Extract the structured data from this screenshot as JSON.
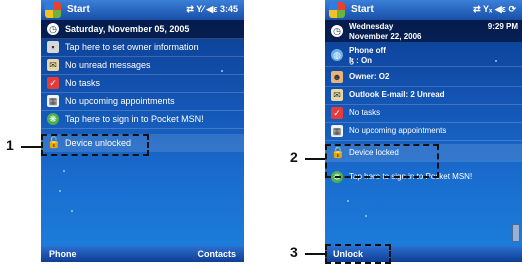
{
  "screen1": {
    "title": "Start",
    "status": "⇄ Y⁄ ◀ε 3:45",
    "date": "Saturday, November 05, 2005",
    "items": [
      "Tap here to set owner information",
      "No unread messages",
      "No tasks",
      "No upcoming appointments",
      "Tap here to sign in to Pocket MSN!",
      "Device unlocked"
    ],
    "softkey_left": "Phone",
    "softkey_right": "Contacts",
    "callout": "1"
  },
  "screen2": {
    "title": "Start",
    "status": "⇄ Yₓ ◀ε ⟳",
    "date_line1": "Wednesday",
    "date_line2": "November 22, 2006",
    "time": "9:29 PM",
    "phone_line1": "Phone off",
    "phone_line2": ": On",
    "owner": "Owner: O2",
    "email": "Outlook E-mail: 2 Unread",
    "tasks": "No tasks",
    "appointments": "No upcoming appointments",
    "locked": "Device locked",
    "msn": "Tap here to sign in to Pocket MSN!",
    "softkey_left": "Unlock",
    "callout_locked": "2",
    "callout_unlock": "3"
  },
  "colors": {
    "accent": "#1352b0",
    "titlebar": "#1a4fa8",
    "lock": "#f2a21a"
  }
}
